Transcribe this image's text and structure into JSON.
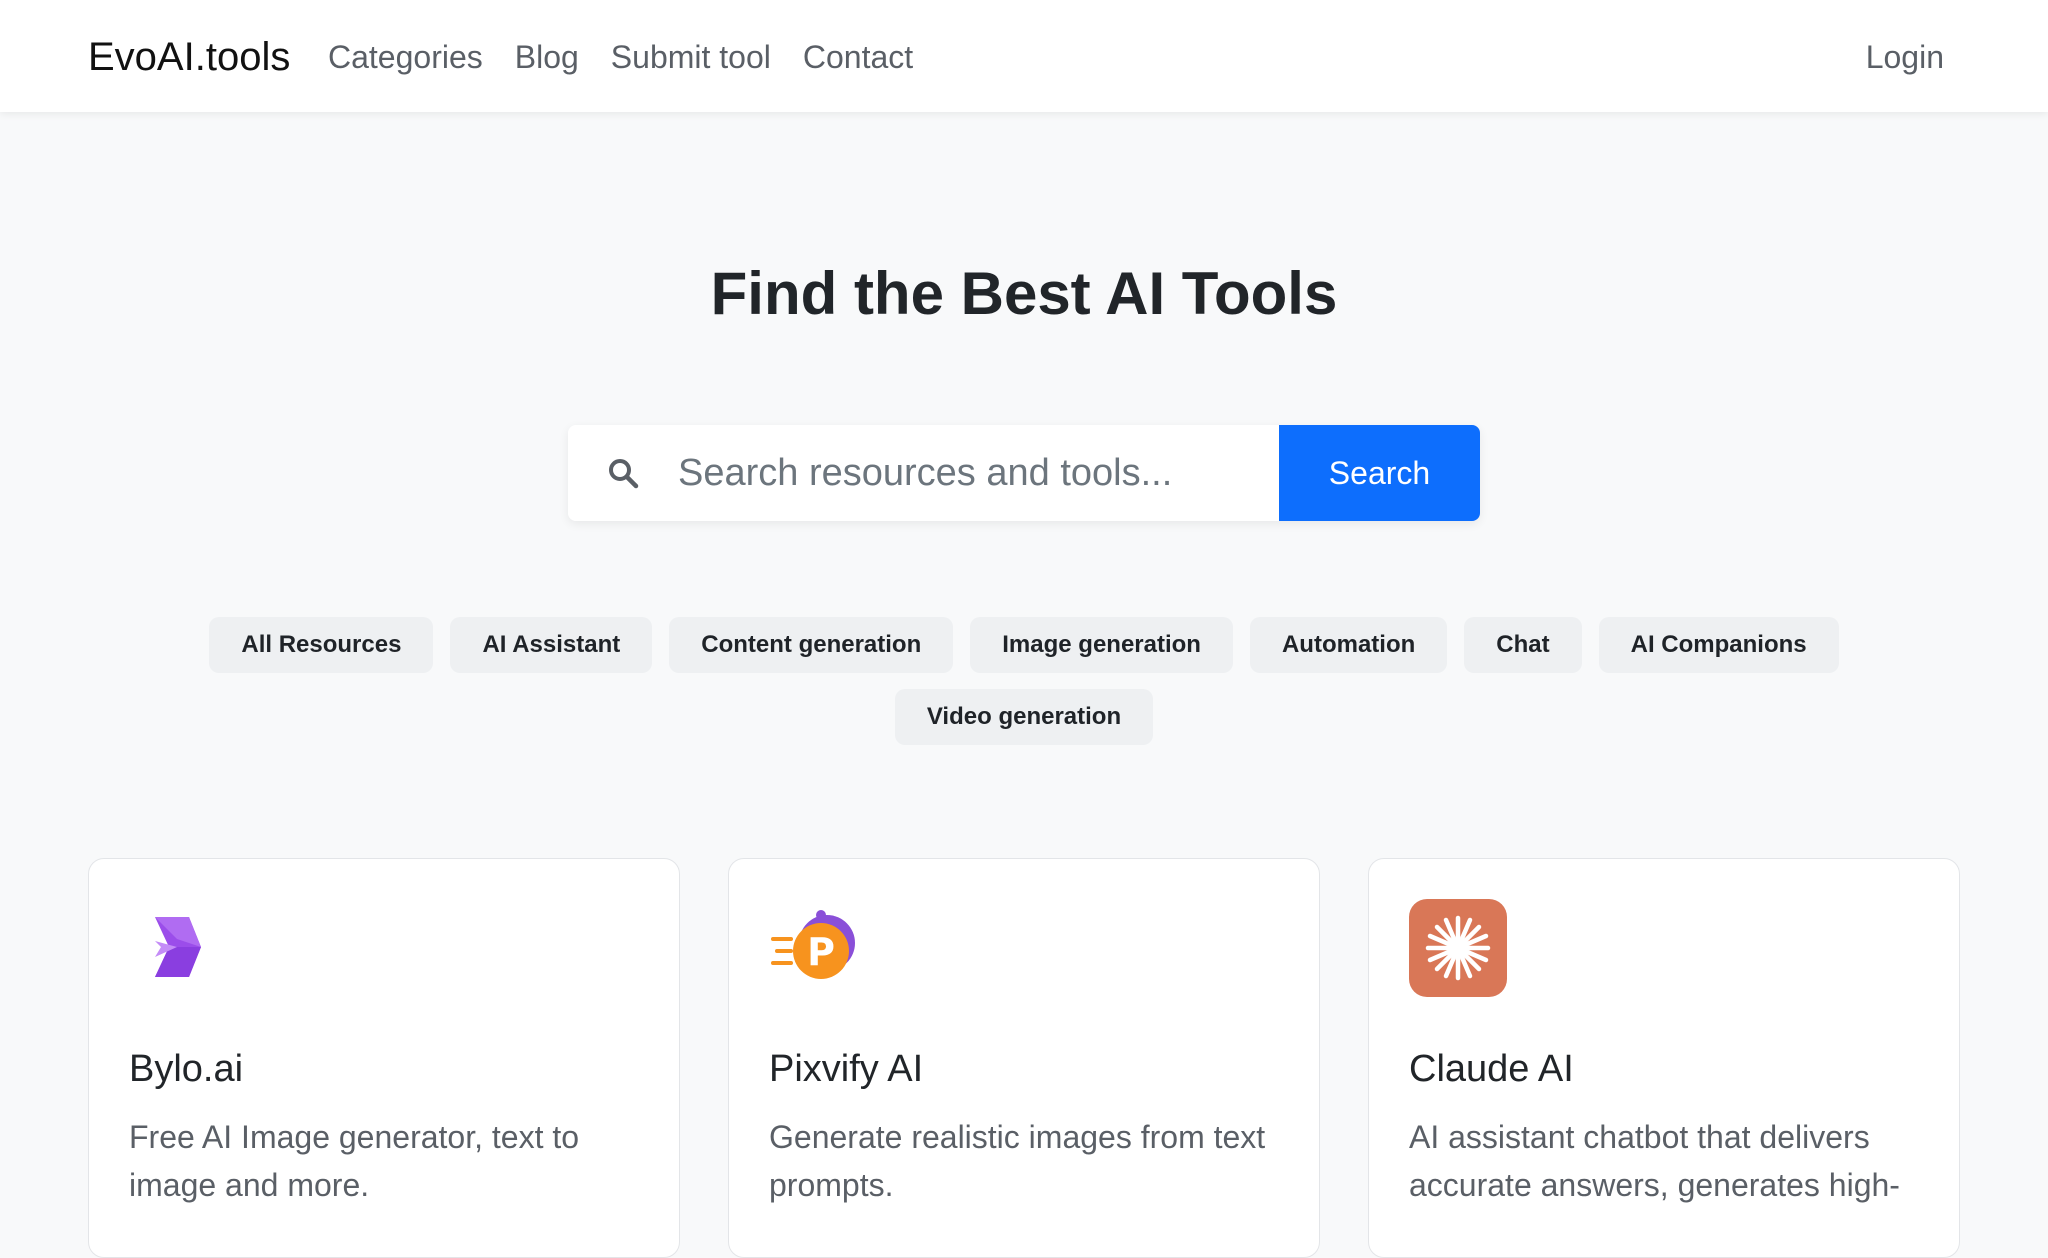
{
  "navbar": {
    "brand": "EvoAI.tools",
    "links": [
      "Categories",
      "Blog",
      "Submit tool",
      "Contact"
    ],
    "login": "Login"
  },
  "hero": {
    "title": "Find the Best AI Tools"
  },
  "search": {
    "placeholder": "Search resources and tools...",
    "button_label": "Search",
    "icon": "search-icon"
  },
  "categories": [
    "All Resources",
    "AI Assistant",
    "Content generation",
    "Image generation",
    "Automation",
    "Chat",
    "AI Companions",
    "Video generation"
  ],
  "cards": [
    {
      "title": "Bylo.ai",
      "description": "Free AI Image generator, text to image and more.",
      "icon": "bylo-logo-icon"
    },
    {
      "title": "Pixvify AI",
      "description": "Generate realistic images from text prompts.",
      "icon": "pixvify-logo-icon"
    },
    {
      "title": "Claude AI",
      "description": "AI assistant chatbot that delivers accurate answers, generates high-",
      "icon": "claude-logo-icon"
    }
  ],
  "colors": {
    "primary": "#0d6efd",
    "page_bg": "#f8f9fa",
    "pill_bg": "#eef0f2",
    "claude_orange": "#d97757"
  }
}
